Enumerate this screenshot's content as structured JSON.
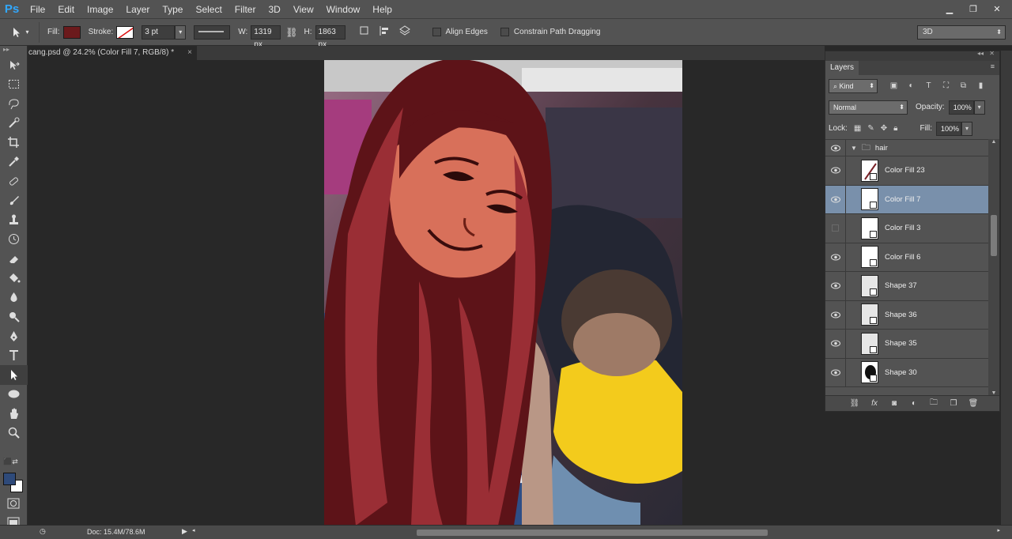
{
  "app": {
    "logo": "Ps"
  },
  "menu": [
    "File",
    "Edit",
    "Image",
    "Layer",
    "Type",
    "Select",
    "Filter",
    "3D",
    "View",
    "Window",
    "Help"
  ],
  "window_controls": [
    "minimize-icon",
    "restore-icon",
    "close-icon"
  ],
  "options": {
    "fill_label": "Fill:",
    "fill_color": "#6b1a1c",
    "stroke_label": "Stroke:",
    "stroke_size": "3 pt",
    "w_label": "W:",
    "w_value": "1319 px",
    "h_label": "H:",
    "h_value": "1863 px",
    "align_edges": "Align Edges",
    "constrain": "Constrain Path Dragging",
    "workspace": "3D"
  },
  "document": {
    "tab_title": "cang.psd @ 24.2% (Color Fill 7, RGB/8) *",
    "close": "×"
  },
  "status": {
    "doc": "Doc: 15.4M/78.6M"
  },
  "colors": {
    "foreground": "#2e4a7a",
    "background": "#ffffff",
    "hair": "#7a2228",
    "skin": "#d8705a"
  },
  "tools": [
    "move-icon",
    "marquee-icon",
    "lasso-icon",
    "quick-select-icon",
    "crop-icon",
    "eyedropper-icon",
    "healing-icon",
    "brush-icon",
    "stamp-icon",
    "history-brush-icon",
    "eraser-icon",
    "paint-bucket-icon",
    "blur-icon",
    "dodge-icon",
    "pen-icon",
    "type-icon",
    "path-select-icon",
    "ellipse-icon",
    "hand-icon",
    "zoom-icon"
  ],
  "layers_panel": {
    "tab": "Layers",
    "kind": "Kind",
    "blend": "Normal",
    "opacity_label": "Opacity:",
    "opacity": "100%",
    "lock_label": "Lock:",
    "fill_label": "Fill:",
    "fill": "100%",
    "group": "hair",
    "layers": [
      {
        "name": "Color Fill 23",
        "visible": true,
        "selected": false
      },
      {
        "name": "Color Fill 7",
        "visible": true,
        "selected": true
      },
      {
        "name": "Color Fill 3",
        "visible": false,
        "selected": false
      },
      {
        "name": "Color Fill 6",
        "visible": true,
        "selected": false
      },
      {
        "name": "Shape 37",
        "visible": true,
        "selected": false
      },
      {
        "name": "Shape 36",
        "visible": true,
        "selected": false
      },
      {
        "name": "Shape 35",
        "visible": true,
        "selected": false
      },
      {
        "name": "Shape 30",
        "visible": true,
        "selected": false
      }
    ]
  }
}
